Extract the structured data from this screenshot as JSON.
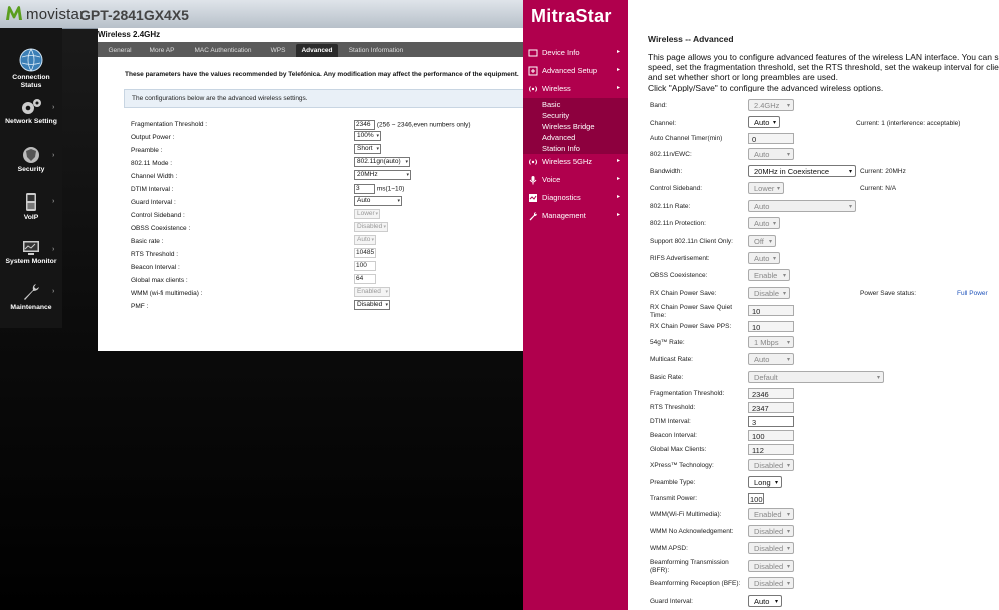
{
  "movistar": {
    "logo": "movistar",
    "model": "GPT-2841GX4X5",
    "sidebar": [
      {
        "label": "Connection Status",
        "icon": "globe-icon"
      },
      {
        "label": "Network Setting",
        "icon": "gears-icon"
      },
      {
        "label": "Security",
        "icon": "shield-icon"
      },
      {
        "label": "VoIP",
        "icon": "phone-icon"
      },
      {
        "label": "System Monitor",
        "icon": "monitor-icon"
      },
      {
        "label": "Maintenance",
        "icon": "wrench-icon"
      }
    ],
    "section_title": "Wireless 2.4GHz",
    "tabs": [
      "General",
      "More AP",
      "MAC Authentication",
      "WPS",
      "Advanced",
      "Station Information"
    ],
    "active_tab": "Advanced",
    "warning": "These parameters have the values recommended by Telefónica. Any modification may affect the performance of the equipment.",
    "info": "The configurations below are the advanced wireless settings.",
    "rows": [
      {
        "label": "Fragmentation Threshold :",
        "value": "2346",
        "hint": "(256 ~ 2346,even numbers only)"
      },
      {
        "label": "Output Power :",
        "value": "100%"
      },
      {
        "label": "Preamble :",
        "value": "Short"
      },
      {
        "label": "802.11 Mode :",
        "value": "802.11gn(auto)"
      },
      {
        "label": "Channel Width :",
        "value": "20MHz"
      },
      {
        "label": "DTIM Interval :",
        "value": "3",
        "hint": "ms(1~10)"
      },
      {
        "label": "Guard Interval :",
        "value": "Auto"
      },
      {
        "label": "Control Sideband :",
        "value": "Lower"
      },
      {
        "label": "OBSS Coexistence :",
        "value": "Disabled"
      },
      {
        "label": "Basic rate :",
        "value": "Auto"
      },
      {
        "label": "RTS Threshold :",
        "value": "10485"
      },
      {
        "label": "Beacon Interval :",
        "value": "100"
      },
      {
        "label": "Global max clients :",
        "value": "64"
      },
      {
        "label": "WMM (wi-fi multimedia) :",
        "value": "Enabled"
      },
      {
        "label": "PMF :",
        "value": "Disabled"
      }
    ]
  },
  "mitrastar": {
    "logo": "MitraStar",
    "nav": [
      {
        "label": "Device Info",
        "icon": "device-icon"
      },
      {
        "label": "Advanced Setup",
        "icon": "advanced-setup-icon"
      },
      {
        "label": "Wireless",
        "icon": "wireless-icon"
      },
      {
        "label": "Wireless 5GHz",
        "icon": "wireless-icon"
      },
      {
        "label": "Voice",
        "icon": "voice-icon"
      },
      {
        "label": "Diagnostics",
        "icon": "diagnostics-icon"
      },
      {
        "label": "Management",
        "icon": "management-icon"
      }
    ],
    "wireless_sub": [
      "Basic",
      "Security",
      "Wireless Bridge",
      "Advanced",
      "Station Info"
    ],
    "title": "Wireless -- Advanced",
    "description": [
      "This page allows you to configure advanced features of the wireless LAN interface. You can select a p",
      "speed, set the fragmentation threshold, set the RTS threshold, set the wakeup interval for clients in po",
      "and set whether short or long preambles are used.",
      "Click \"Apply/Save\" to configure the advanced wireless options."
    ],
    "rows": [
      {
        "label": "Band:",
        "value": "2.4GHz"
      },
      {
        "label": "Channel:",
        "value": "Auto",
        "note": "Current: 1 (interference: acceptable)"
      },
      {
        "label": "Auto Channel Timer(min)",
        "value": "0"
      },
      {
        "label": "802.11n/EWC:",
        "value": "Auto"
      },
      {
        "label": "Bandwidth:",
        "value": "20MHz in Coexistence",
        "note": "Current: 20MHz"
      },
      {
        "label": "Control Sideband:",
        "value": "Lower",
        "note": "Current: N/A"
      },
      {
        "label": "802.11n Rate:",
        "value": "Auto"
      },
      {
        "label": "802.11n Protection:",
        "value": "Auto"
      },
      {
        "label": "Support 802.11n Client Only:",
        "value": "Off"
      },
      {
        "label": "RIFS Advertisement:",
        "value": "Auto"
      },
      {
        "label": "OBSS Coexistence:",
        "value": "Enable"
      },
      {
        "label": "RX Chain Power Save:",
        "value": "Disable",
        "note": "Power Save status:",
        "link": "Full Power"
      },
      {
        "label": "RX Chain Power Save Quiet Time:",
        "value": "10"
      },
      {
        "label": "RX Chain Power Save PPS:",
        "value": "10"
      },
      {
        "label": "54g™ Rate:",
        "value": "1 Mbps"
      },
      {
        "label": "Multicast Rate:",
        "value": "Auto"
      },
      {
        "label": "Basic Rate:",
        "value": "Default"
      },
      {
        "label": "Fragmentation Threshold:",
        "value": "2346"
      },
      {
        "label": "RTS Threshold:",
        "value": "2347"
      },
      {
        "label": "DTIM Interval:",
        "value": "3"
      },
      {
        "label": "Beacon Interval:",
        "value": "100"
      },
      {
        "label": "Global Max Clients:",
        "value": "112"
      },
      {
        "label": "XPress™ Technology:",
        "value": "Disabled"
      },
      {
        "label": "Preamble Type:",
        "value": "Long"
      },
      {
        "label": "Transmit Power:",
        "value": "100"
      },
      {
        "label": "WMM(Wi-Fi Multimedia):",
        "value": "Enabled"
      },
      {
        "label": "WMM No Acknowledgement:",
        "value": "Disabled"
      },
      {
        "label": "WMM APSD:",
        "value": "Disabled"
      },
      {
        "label": "Beamforming Transmission (BFR):",
        "value": "Disabled"
      },
      {
        "label": "Beamforming Reception (BFE):",
        "value": "Disabled"
      },
      {
        "label": "Guard Interval:",
        "value": "Auto"
      }
    ]
  }
}
